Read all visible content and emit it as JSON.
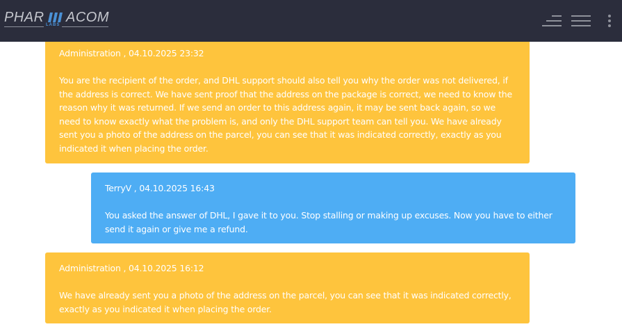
{
  "header": {
    "logo_left": "PHAR",
    "logo_right": "ACOM",
    "logo_sub": "LABS"
  },
  "messages": [
    {
      "sender": "Administration , 04.10.2025 23:32",
      "text": "You are the recipient of the order, and DHL support should also tell you why the order was not delivered, if the address is correct. We have sent proof that the address on the package is correct, we need to know the reason why it was returned. If we send an order to this address again, it may be sent back again, so we need to know exactly what the problem is, and only the DHL support team can tell you. We have already sent you a photo of the address on the parcel, you can see that it was indicated correctly, exactly as you indicated it when placing the order."
    },
    {
      "sender": "TerryV , 04.10.2025 16:43",
      "text": "You asked the answer of DHL, I gave it to you. Stop stalling or making up excuses. Now you have to either send it again or give me a refund."
    },
    {
      "sender": "Administration , 04.10.2025 16:12",
      "text": "We have already sent you a photo of the address on the parcel, you can see that it was indicated correctly, exactly as you indicated it when placing the order."
    }
  ],
  "colors": {
    "topbar": "#2b2d3c",
    "admin_bubble": "#fec43d",
    "user_bubble": "#4eadf4",
    "logo_accent": "#4a91d6"
  },
  "icons": {
    "menu_left": "hamburger-stepped-icon",
    "menu_right": "hamburger-icon",
    "more": "kebab-menu-icon"
  }
}
